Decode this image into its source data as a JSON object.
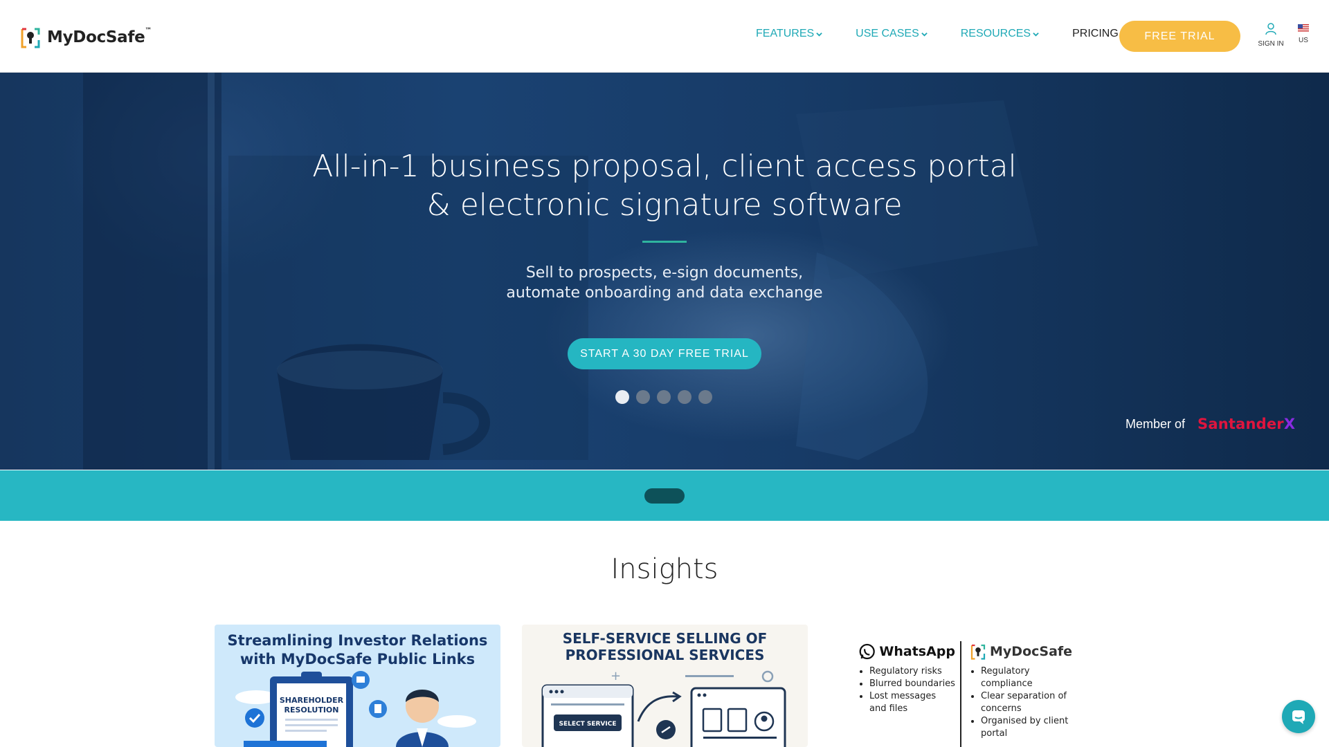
{
  "brand": {
    "name": "MyDocSafe",
    "tm": "™"
  },
  "nav": {
    "items": [
      {
        "label": "FEATURES",
        "dropdown": true
      },
      {
        "label": "USE CASES",
        "dropdown": true
      },
      {
        "label": "RESOURCES",
        "dropdown": true
      },
      {
        "label": "PRICING",
        "dropdown": false
      }
    ],
    "trial_label": "FREE TRIAL",
    "signin_label": "SIGN IN",
    "locale_label": "US"
  },
  "hero": {
    "title_line1": "All-in-1 business proposal, client access portal",
    "title_line2": "& electronic signature software",
    "subtitle_line1": "Sell to prospects, e-sign documents,",
    "subtitle_line2": "automate onboarding and data exchange",
    "cta_label": "START A 30 DAY FREE TRIAL",
    "slides": 5,
    "active_slide": 1,
    "member_label": "Member of",
    "partner_name": "Santander",
    "partner_suffix": "X"
  },
  "insights": {
    "title": "Insights",
    "cards": [
      {
        "title_line1": "Streamlining Investor Relations",
        "title_line2": "with MyDocSafe Public Links",
        "doc_label_line1": "SHAREHOLDER",
        "doc_label_line2": "RESOLUTION"
      },
      {
        "title_line1": "SELF-SERVICE SELLING OF",
        "title_line2": "PROFESSIONAL SERVICES",
        "button_label": "SELECT SERVICE"
      },
      {
        "left_brand": "WhatsApp",
        "left_points": [
          "Regulatory risks",
          "Blurred boundaries",
          "Lost messages and files"
        ],
        "right_brand": "MyDocSafe",
        "right_points": [
          "Regulatory compliance",
          "Clear separation of concerns",
          "Organised by client portal"
        ]
      }
    ]
  },
  "colors": {
    "accent": "#1fa9b6",
    "trial_button": "#f7bd45",
    "band": "#27b7c3",
    "hero_bg": "#173b67"
  },
  "icons": {
    "signin": "user-icon",
    "locale": "us-flag-icon",
    "chat": "chat-icon"
  }
}
